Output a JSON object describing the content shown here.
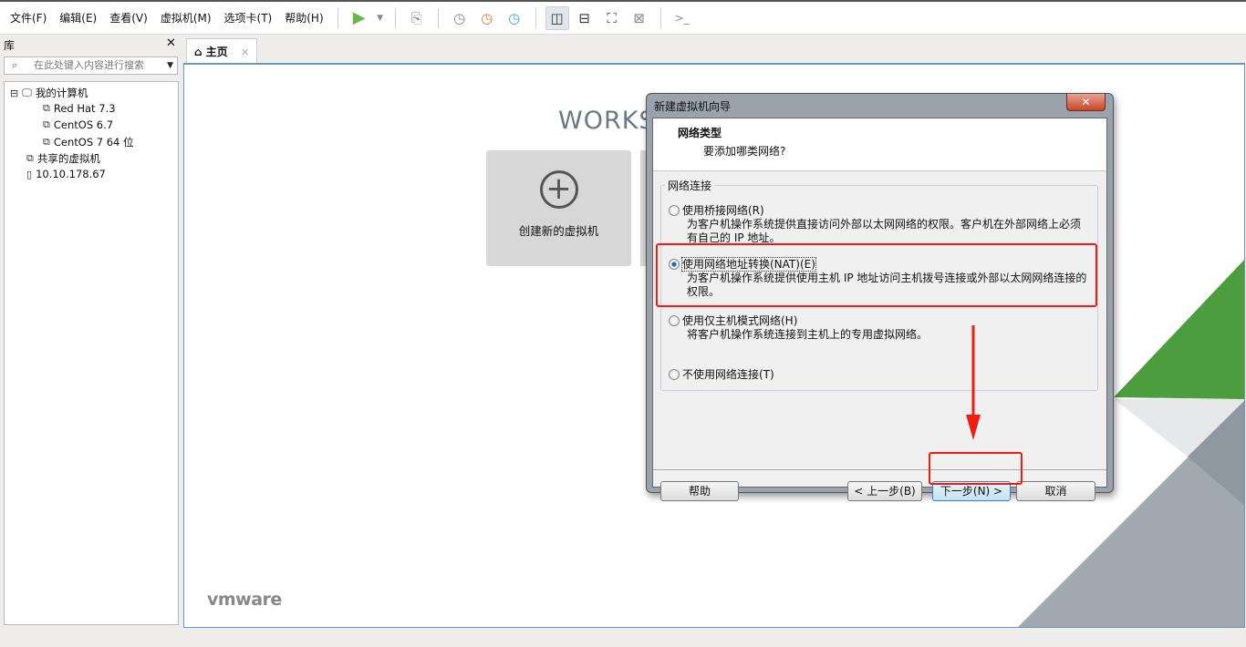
{
  "menubar": {
    "items": [
      "文件(F)",
      "编辑(E)",
      "查看(V)",
      "虚拟机(M)",
      "选项卡(T)",
      "帮助(H)"
    ]
  },
  "library": {
    "title": "库",
    "close": "✕",
    "search_placeholder": "在此处键入内容进行搜索",
    "tree": {
      "root": "我的计算机",
      "vms": [
        "Red Hat 7.3",
        "CentOS 6.7",
        "CentOS 7 64 位"
      ],
      "shared": "共享的虚拟机",
      "remote": "10.10.178.67"
    }
  },
  "tab": {
    "label": "主页",
    "close": "×"
  },
  "home": {
    "heading": "WORKS",
    "create_label": "创建新的虚拟机",
    "logo": "vmware"
  },
  "dialog": {
    "title": "新建虚拟机向导",
    "close": "✕",
    "header_title": "网络类型",
    "header_subtitle": "要添加哪类网络?",
    "group_label": "网络连接",
    "options": [
      {
        "label": "使用桥接网络(R)",
        "desc": "为客户机操作系统提供直接访问外部以太网网络的权限。客户机在外部网络上必须有自己的 IP 地址。",
        "selected": false
      },
      {
        "label": "使用网络地址转换(NAT)(E)",
        "desc": "为客户机操作系统提供使用主机 IP 地址访问主机拨号连接或外部以太网网络连接的权限。",
        "selected": true
      },
      {
        "label": "使用仅主机模式网络(H)",
        "desc": "将客户机操作系统连接到主机上的专用虚拟网络。",
        "selected": false
      },
      {
        "label": "不使用网络连接(T)",
        "desc": "",
        "selected": false
      }
    ],
    "buttons": {
      "help": "帮助",
      "back": "< 上一步(B)",
      "next": "下一步(N) >",
      "cancel": "取消"
    }
  },
  "colors": {
    "annotation": "#f01c10",
    "vmware_green": "#4d9f3f",
    "accent_blue": "#6a98b6"
  }
}
